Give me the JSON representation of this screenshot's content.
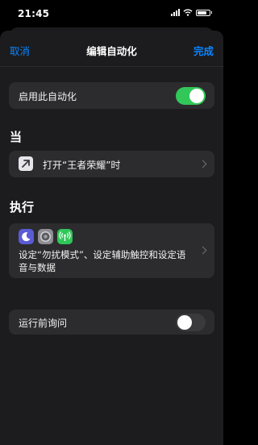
{
  "status_bar": {
    "time": "21:45"
  },
  "nav": {
    "cancel": "取消",
    "title": "编辑自动化",
    "done": "完成"
  },
  "enable_row": {
    "label": "启用此自动化",
    "enabled": true
  },
  "when_section": {
    "title": "当",
    "trigger_label": "打开“王者荣耀”时",
    "trigger_icon": "arrow-up-right-icon"
  },
  "do_section": {
    "title": "执行",
    "icons": [
      "moon-icon",
      "gear-icon",
      "cellular-icon"
    ],
    "description": "设定“勿扰模式”、设定辅助触控和设定语音与数据"
  },
  "ask_row": {
    "label": "运行前询问",
    "enabled": false
  },
  "colors": {
    "accent": "#0a84ff",
    "toggle_on": "#32c759",
    "background": "#000000",
    "card": "#2c2c2e"
  }
}
